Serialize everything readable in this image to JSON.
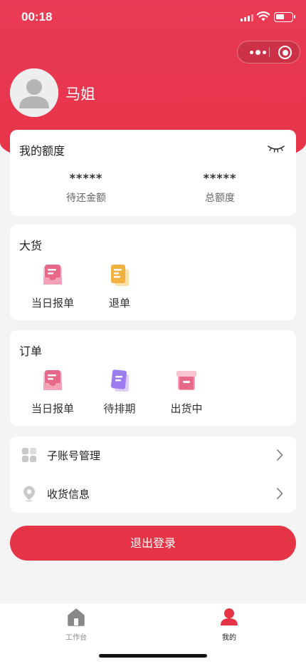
{
  "status_bar": {
    "time": "00:18"
  },
  "user": {
    "name": "马姐"
  },
  "quota": {
    "title": "我的额度",
    "items": [
      {
        "value": "*****",
        "label": "待还金额"
      },
      {
        "value": "*****",
        "label": "总额度"
      }
    ]
  },
  "goods": {
    "title": "大货",
    "items": [
      {
        "label": "当日报单",
        "icon": "report-tray-icon"
      },
      {
        "label": "退单",
        "icon": "refund-document-icon"
      }
    ]
  },
  "orders": {
    "title": "订单",
    "items": [
      {
        "label": "当日报单",
        "icon": "report-tray-icon"
      },
      {
        "label": "待排期",
        "icon": "schedule-document-icon"
      },
      {
        "label": "出货中",
        "icon": "shipping-box-icon"
      }
    ]
  },
  "menu": [
    {
      "label": "子账号管理",
      "icon": "grid-apps-icon"
    },
    {
      "label": "收货信息",
      "icon": "location-pin-icon"
    }
  ],
  "logout_label": "退出登录",
  "tabbar": [
    {
      "label": "工作台",
      "icon": "home-icon",
      "active": false
    },
    {
      "label": "我的",
      "icon": "user-icon",
      "active": true
    }
  ],
  "colors": {
    "brand_red": "#e43446",
    "tab_active": "#e43446",
    "tab_inactive": "#888888",
    "pink": "#e8688a",
    "orange": "#f0b140",
    "purple": "#9d7cf0"
  }
}
